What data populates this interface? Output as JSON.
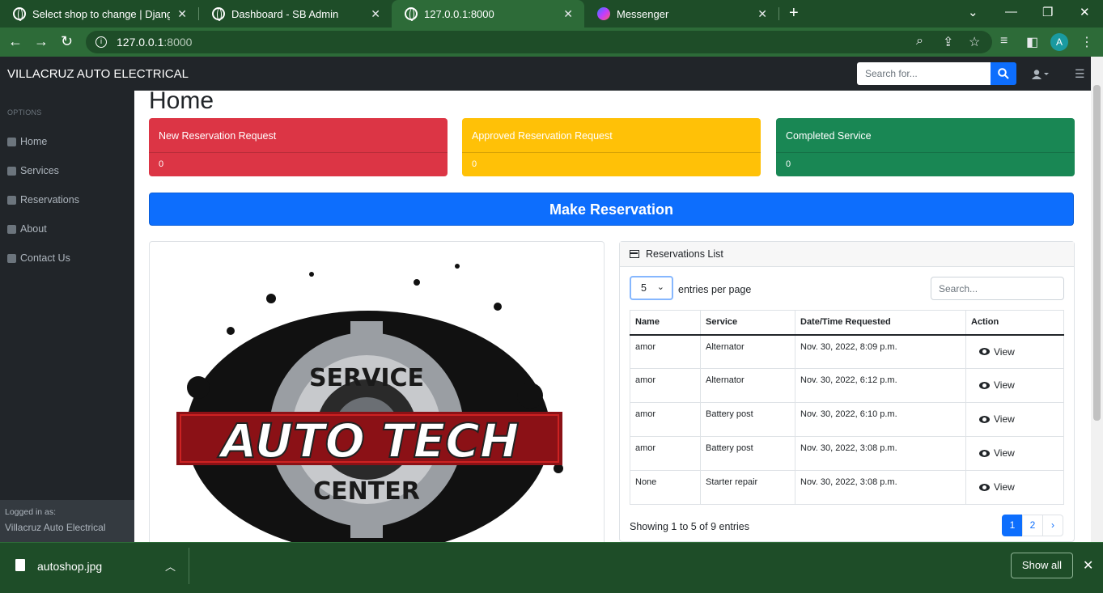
{
  "browser": {
    "tabs": [
      {
        "title": "Select shop to change | Django s",
        "icon": "globe-icon"
      },
      {
        "title": "Dashboard - SB Admin",
        "icon": "globe-icon"
      },
      {
        "title": "127.0.0.1:8000",
        "icon": "globe-icon"
      },
      {
        "title": "Messenger",
        "icon": "messenger-icon"
      }
    ],
    "url_host": "127.0.0.1",
    "url_port": ":8000",
    "avatar_letter": "A"
  },
  "app": {
    "brand": "VILLACRUZ AUTO ELECTRICAL",
    "search_placeholder": "Search for...",
    "sidebar": {
      "heading": "OPTIONS",
      "items": [
        {
          "label": "Home",
          "icon": "home-icon"
        },
        {
          "label": "Services",
          "icon": "car-icon"
        },
        {
          "label": "Reservations",
          "icon": "list-icon"
        },
        {
          "label": "About",
          "icon": "id-card-icon"
        },
        {
          "label": "Contact Us",
          "icon": "broadcast-icon"
        }
      ],
      "footer_label": "Logged in as:",
      "footer_user": "Villacruz Auto Electrical"
    },
    "page_title": "Home",
    "stat_cards": [
      {
        "title": "New Reservation Request",
        "value": "0",
        "color": "#dc3545"
      },
      {
        "title": "Approved Reservation Request",
        "value": "0",
        "color": "#ffc107"
      },
      {
        "title": "Completed Service",
        "value": "0",
        "color": "#198754"
      }
    ],
    "make_reservation": "Make Reservation",
    "logo": {
      "top": "SERVICE",
      "middle": "AUTO TECH",
      "bottom": "CENTER"
    },
    "reservations": {
      "title": "Reservations List",
      "per_page_value": "5",
      "per_page_label": "entries per page",
      "search_placeholder": "Search...",
      "columns": [
        "Name",
        "Service",
        "Date/Time Requested",
        "Action"
      ],
      "rows": [
        {
          "name": "amor",
          "service": "Alternator",
          "datetime": "Nov. 30, 2022, 8:09 p.m.",
          "action": "View"
        },
        {
          "name": "amor",
          "service": "Alternator",
          "datetime": "Nov. 30, 2022, 6:12 p.m.",
          "action": "View"
        },
        {
          "name": "amor",
          "service": "Battery post",
          "datetime": "Nov. 30, 2022, 6:10 p.m.",
          "action": "View"
        },
        {
          "name": "amor",
          "service": "Battery post",
          "datetime": "Nov. 30, 2022, 3:08 p.m.",
          "action": "View"
        },
        {
          "name": "None",
          "service": "Starter repair",
          "datetime": "Nov. 30, 2022, 3:08 p.m.",
          "action": "View"
        }
      ],
      "showing": "Showing 1 to 5 of 9 entries",
      "pages": [
        "1",
        "2",
        "›"
      ]
    }
  },
  "download": {
    "filename": "autoshop.jpg",
    "show_all": "Show all"
  }
}
